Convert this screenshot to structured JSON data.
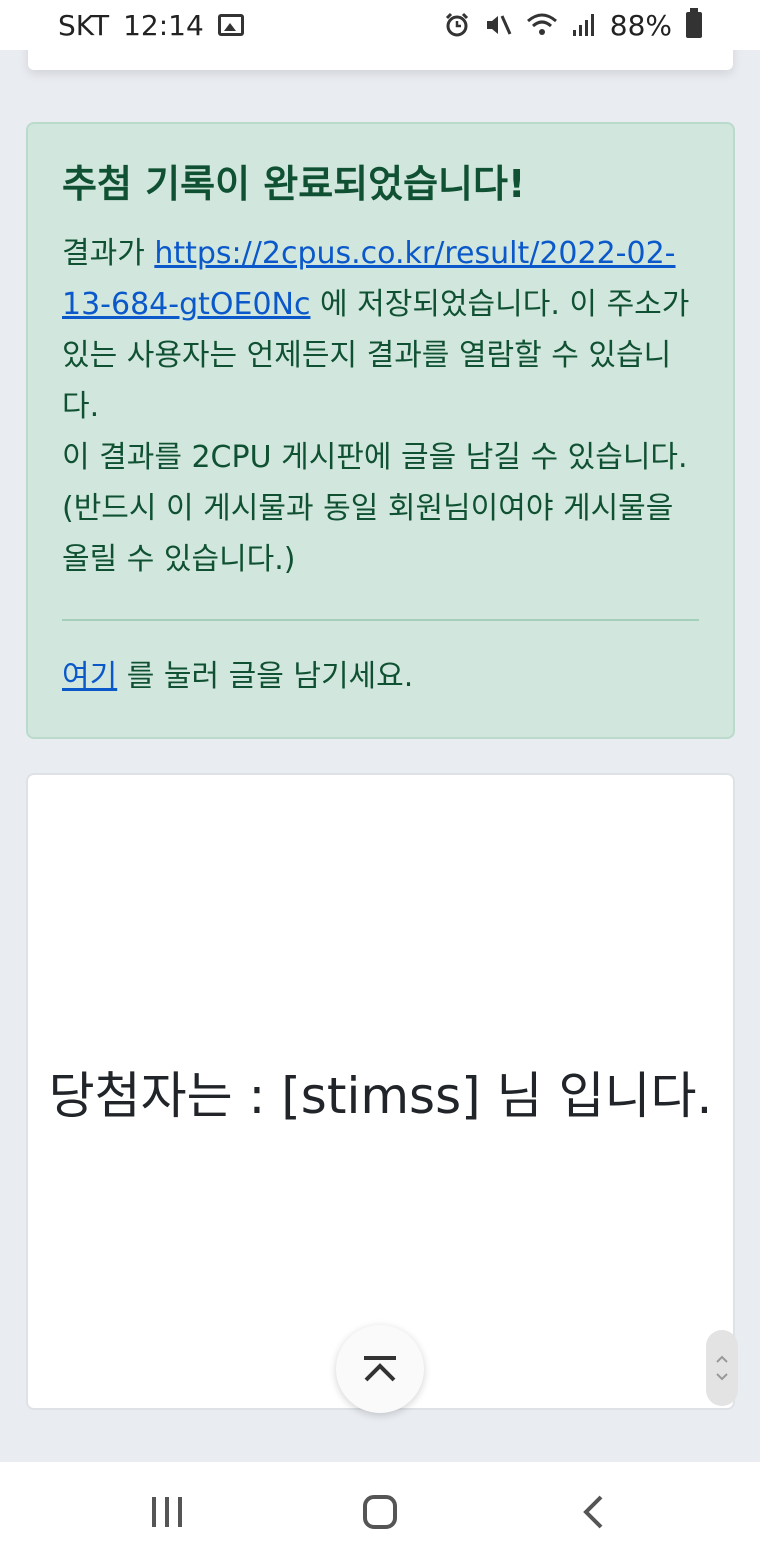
{
  "status_bar": {
    "carrier": "SKT",
    "time": "12:14",
    "battery": "88%",
    "icons": [
      "image-icon",
      "alarm-icon",
      "mute-icon",
      "wifi-icon",
      "signal-icon",
      "battery-icon"
    ]
  },
  "alert": {
    "title": "추첨 기록이 완료되었습니다!",
    "prefix": "결과가 ",
    "link": "https://2cpus.co.kr/result/2022-02-13-684-gtOE0Nc",
    "suffix": " 에 저장되었습니다. 이 주소가 있는 사용자는 언제든지 결과를 열람할 수 있습니다.",
    "board_note": "이 결과를 2CPU 게시판에 글을 남길 수 있습니다. (반드시 이 게시물과 동일 회원님이여야 게시물을 올릴 수 있습니다.)",
    "footer_link": "여기",
    "footer_text": " 를 눌러 글을 남기세요."
  },
  "winner": {
    "text": "당첨자는 : [stimss] 님 입니다."
  },
  "colors": {
    "alert_bg": "#d1e7dd",
    "alert_text": "#0f5132",
    "link": "#0a58ca",
    "page_bg": "#e9ecf1"
  },
  "nav_icons": [
    "recent-apps-icon",
    "home-icon",
    "back-icon"
  ]
}
